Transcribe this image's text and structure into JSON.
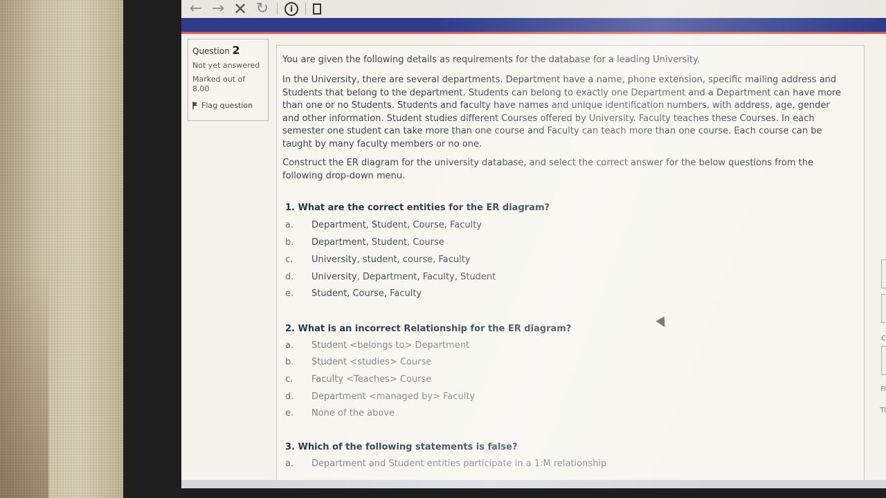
{
  "toolbar": {
    "back_icon": "←",
    "forward_icon": "→",
    "close_icon": "✕",
    "reload_icon": "↻",
    "info_icon": "i"
  },
  "info": {
    "question_label": "Question",
    "question_number": "2",
    "status": "Not yet answered",
    "marked": "Marked out of 8.00",
    "flag_label": "Flag question"
  },
  "content": {
    "intro": "You are given the following details as requirements for the database for a leading University.",
    "description": "In the University, there are several departments. Department have a name, phone extension, specific mailing address and Students that belong to the department. Students can belong to exactly one Department and a Department can have more than one or no Students. Students and faculty have names and unique identification numbers, with address, age, gender and other information. Student studies different Courses offered by University. Faculty teaches these Courses. In each semester one student can take more than one course and Faculty can teach more than one course. Each course can be taught by many faculty members or no one.",
    "instruction": "Construct the ER diagram for the university database, and select the correct answer for the below questions from the following drop-down menu.",
    "q1": {
      "title": "1. What are the correct entities for the ER diagram?",
      "options": [
        {
          "letter": "a.",
          "text": "Department, Student, Course, Faculty"
        },
        {
          "letter": "b.",
          "text": "Department, Student, Course"
        },
        {
          "letter": "c.",
          "text": "University, student, course, Faculty"
        },
        {
          "letter": "d.",
          "text": "University, Department, Faculty, Student"
        },
        {
          "letter": "e.",
          "text": "Student, Course, Faculty"
        }
      ]
    },
    "q2": {
      "title": "2. What is an incorrect Relationship for the ER diagram?",
      "options": [
        {
          "letter": "a.",
          "text": "Student <belongs to> Department"
        },
        {
          "letter": "b.",
          "text": "Student <studies> Course"
        },
        {
          "letter": "c.",
          "text": "Faculty <Teaches> Course"
        },
        {
          "letter": "d.",
          "text": "Department <managed by> Faculty"
        },
        {
          "letter": "e.",
          "text": "None of the above"
        }
      ]
    },
    "q3": {
      "title": "3. Which of the following statements is false?",
      "options": [
        {
          "letter": "a.",
          "text": "Department and Student entities participate in a 1:M relationship"
        }
      ]
    }
  },
  "right_edge": {
    "letter_c": "C",
    "text_fi": "Fi",
    "text_ti": "Ti"
  }
}
